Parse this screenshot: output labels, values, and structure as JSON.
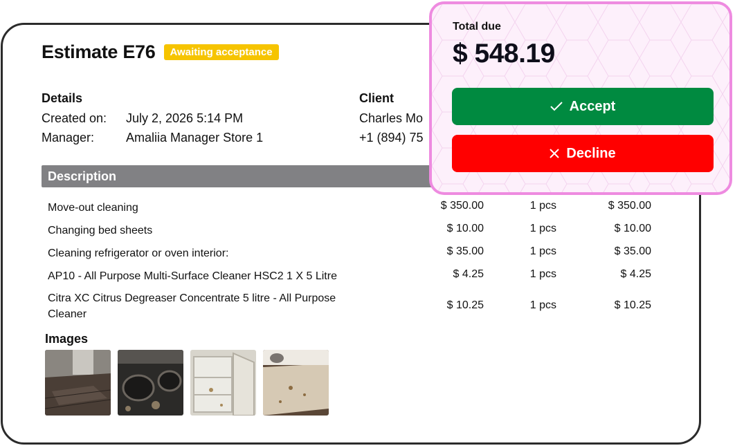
{
  "estimate": {
    "title": "Estimate E76",
    "status_badge": "Awaiting acceptance"
  },
  "details": {
    "heading": "Details",
    "created_label": "Created on:",
    "created_value": "July 2, 2026 5:14 PM",
    "manager_label": "Manager:",
    "manager_value": "Amaliia Manager Store 1"
  },
  "client": {
    "heading": "Client",
    "name": "Charles Mo",
    "phone": "+1 (894) 75"
  },
  "description": {
    "heading": "Description",
    "rows": [
      {
        "desc": "Move-out cleaning",
        "price": "$ 350.00",
        "qty": "1 pcs",
        "total": "$ 350.00"
      },
      {
        "desc": "Changing bed sheets",
        "price": "$ 10.00",
        "qty": "1 pcs",
        "total": "$ 10.00"
      },
      {
        "desc": "Cleaning refrigerator or oven interior:",
        "price": "$ 35.00",
        "qty": "1 pcs",
        "total": "$ 35.00"
      },
      {
        "desc": "AP10 - All Purpose Multi-Surface Cleaner HSC2 1 X 5 Litre",
        "price": "$ 4.25",
        "qty": "1 pcs",
        "total": "$ 4.25"
      },
      {
        "desc": "Citra XC Citrus Degreaser Concentrate 5 litre - All Purpose Cleaner",
        "price": "$ 10.25",
        "qty": "1 pcs",
        "total": "$ 10.25"
      }
    ]
  },
  "images": {
    "heading": "Images"
  },
  "summary": {
    "total_label": "Total due",
    "total_amount": "$ 548.19",
    "accept_label": "Accept",
    "decline_label": "Decline"
  },
  "colors": {
    "badge": "#f6c400",
    "accept": "#008a40",
    "decline": "#ff0000",
    "panel_border": "#ee8be0",
    "description_bar": "#818184"
  }
}
